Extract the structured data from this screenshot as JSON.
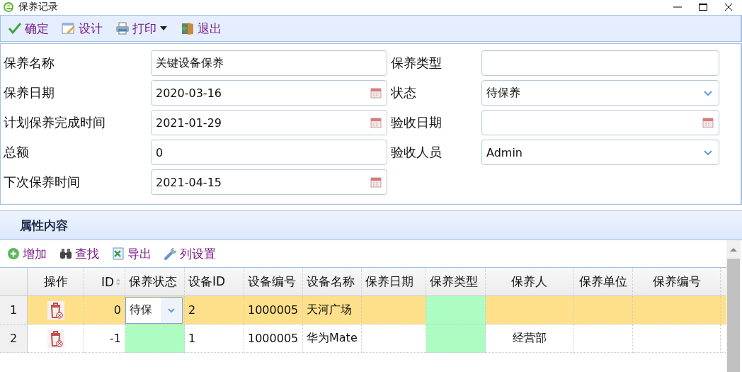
{
  "window": {
    "title": "保养记录"
  },
  "toolbar": [
    {
      "label": "确定",
      "kind": "check",
      "dropdown": false
    },
    {
      "label": "设计",
      "kind": "design",
      "dropdown": false
    },
    {
      "label": "打印",
      "kind": "print",
      "dropdown": true
    },
    {
      "label": "退出",
      "kind": "exit",
      "dropdown": false
    }
  ],
  "form": [
    {
      "label": "保养名称",
      "value": "关键设备保养",
      "kind": "text"
    },
    {
      "label": "保养类型",
      "kind": "text"
    },
    {
      "label": "保养日期",
      "value": "2020-03-16",
      "kind": "date"
    },
    {
      "label": "状态",
      "value": "待保养",
      "kind": "select"
    },
    {
      "label": "计划保养完成时间",
      "value": "2021-01-29",
      "kind": "date"
    },
    {
      "label": "验收日期",
      "kind": "date"
    },
    {
      "label": "总额",
      "value": "0",
      "kind": "text"
    },
    {
      "label": "验收人员",
      "value": "Admin",
      "kind": "select"
    },
    {
      "label": "下次保养时间",
      "value": "2021-04-15",
      "kind": "date"
    }
  ],
  "section": {
    "title": "属性内容"
  },
  "grid_toolbar": [
    {
      "label": "增加",
      "kind": "add"
    },
    {
      "label": "查找",
      "kind": "find"
    },
    {
      "label": "导出",
      "kind": "export"
    },
    {
      "label": "列设置",
      "kind": "settings"
    }
  ],
  "table": {
    "columns": [
      {
        "label": "操作",
        "editable": false,
        "sortable": false
      },
      {
        "label": "ID",
        "editable": false,
        "sortable": true
      },
      {
        "label": "保养状态",
        "editable": true,
        "sortable": false
      },
      {
        "label": "设备ID",
        "editable": false,
        "sortable": false
      },
      {
        "label": "设备编号",
        "editable": false,
        "sortable": false
      },
      {
        "label": "设备名称",
        "editable": false,
        "sortable": false
      },
      {
        "label": "保养日期",
        "editable": false,
        "sortable": false
      },
      {
        "label": "保养类型",
        "editable": true,
        "sortable": false
      },
      {
        "label": "保养人",
        "editable": false,
        "sortable": false
      },
      {
        "label": "保养单位",
        "editable": false,
        "sortable": false
      },
      {
        "label": "保养编号",
        "editable": false,
        "sortable": false
      }
    ],
    "rows": [
      {
        "number": "1",
        "selected": true,
        "editing": true,
        "cells": [
          null,
          "0",
          "待保",
          "2",
          "1000005",
          "天河广场",
          null,
          null,
          null,
          null,
          null
        ]
      },
      {
        "number": "2",
        "selected": false,
        "editing": false,
        "cells": [
          null,
          "-1",
          null,
          "1",
          "1000005",
          "华为Mate",
          null,
          null,
          "经营部",
          null,
          null
        ]
      }
    ]
  }
}
